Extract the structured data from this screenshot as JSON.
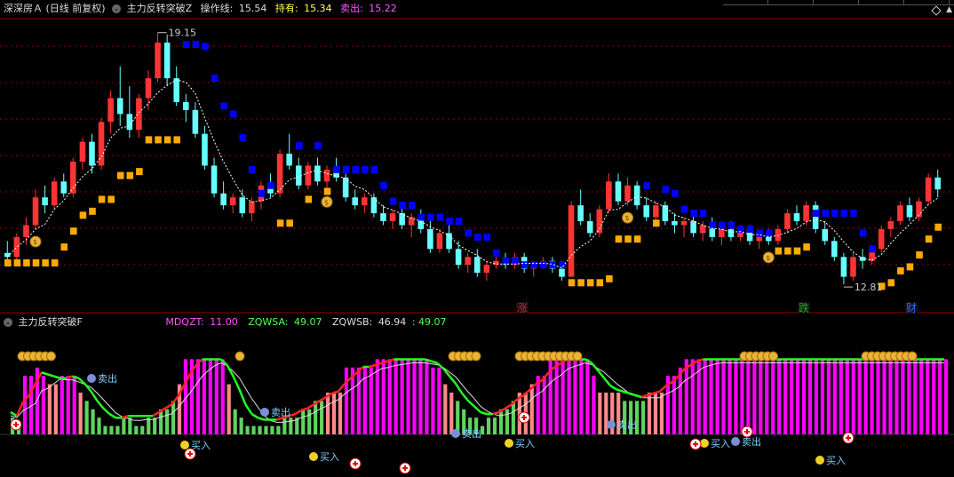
{
  "colors": {
    "up_candle": "#ff3333",
    "down_candle": "#66ffff",
    "support_orange": "#ffaa00",
    "support_blue": "#0000ff",
    "axis_red": "#990000",
    "ind_magenta": "#ff00ff",
    "ind_salmon": "#ff8a8a",
    "ind_green": "#5fd35f",
    "line_green": "#22ff22",
    "line_red": "#ff2222"
  },
  "top_bar": {
    "stock_name": "深深房Ａ",
    "period": "(日线 前复权)",
    "indicator_name": "主力反转突破Z",
    "op_label": "操作线:",
    "op_value": "15.54",
    "hold_label": "持有:",
    "hold_value": "15.34",
    "sell_label": "卖出:",
    "sell_value": "15.22"
  },
  "indicator_bar": {
    "name": "主力反转突破F",
    "mdqzt_label": "MDQZT:",
    "mdqzt_value": "11.00",
    "zqwsa_label": "ZQWSA:",
    "zqwsa_value": "49.07",
    "zqwsb_label": "ZQWSB:",
    "zqwsb_value": "46.94",
    "extra_value": ": 49.07"
  },
  "chart_data": [
    {
      "type": "candlestick",
      "title": "深深房Ａ (日线 前复权)",
      "ohlc_note": "daily candles, approx prices read from chart",
      "high_label": "19.15",
      "low_label": "12.81",
      "news_markers": [
        "涨",
        "跌",
        "财"
      ],
      "candles": [
        [
          13.6,
          13.9,
          13.4,
          13.5
        ],
        [
          13.5,
          14.1,
          13.4,
          14.0
        ],
        [
          14.0,
          14.5,
          13.8,
          14.3
        ],
        [
          14.3,
          15.2,
          14.2,
          15.0
        ],
        [
          15.0,
          15.3,
          14.6,
          14.8
        ],
        [
          14.8,
          15.5,
          14.7,
          15.4
        ],
        [
          15.4,
          15.6,
          15.0,
          15.1
        ],
        [
          15.1,
          16.0,
          15.0,
          15.9
        ],
        [
          15.9,
          16.5,
          15.7,
          16.4
        ],
        [
          16.4,
          16.6,
          15.6,
          15.8
        ],
        [
          15.8,
          17.0,
          15.7,
          16.9
        ],
        [
          16.9,
          17.7,
          16.6,
          17.5
        ],
        [
          17.5,
          18.3,
          16.8,
          17.1
        ],
        [
          17.1,
          17.8,
          16.5,
          16.7
        ],
        [
          16.7,
          17.6,
          16.5,
          17.5
        ],
        [
          17.5,
          18.2,
          17.2,
          18.0
        ],
        [
          18.0,
          19.15,
          17.9,
          18.9
        ],
        [
          18.9,
          19.1,
          17.8,
          18.0
        ],
        [
          18.0,
          18.3,
          17.3,
          17.4
        ],
        [
          17.4,
          17.6,
          16.9,
          17.2
        ],
        [
          17.2,
          17.4,
          16.5,
          16.6
        ],
        [
          16.6,
          16.8,
          15.7,
          15.8
        ],
        [
          15.8,
          16.0,
          15.0,
          15.1
        ],
        [
          15.1,
          15.4,
          14.7,
          14.8
        ],
        [
          14.8,
          15.1,
          14.6,
          15.0
        ],
        [
          15.0,
          15.2,
          14.5,
          14.6
        ],
        [
          14.6,
          15.0,
          14.4,
          14.9
        ],
        [
          14.9,
          15.4,
          14.7,
          15.3
        ],
        [
          15.3,
          15.6,
          15.0,
          15.1
        ],
        [
          15.1,
          16.2,
          15.0,
          16.1
        ],
        [
          16.1,
          16.6,
          15.7,
          15.8
        ],
        [
          15.8,
          16.0,
          15.2,
          15.3
        ],
        [
          15.3,
          15.9,
          15.2,
          15.8
        ],
        [
          15.8,
          16.0,
          15.3,
          15.4
        ],
        [
          15.4,
          15.8,
          15.2,
          15.7
        ],
        [
          15.7,
          16.0,
          15.4,
          15.5
        ],
        [
          15.5,
          15.6,
          14.9,
          15.0
        ],
        [
          15.0,
          15.2,
          14.7,
          14.8
        ],
        [
          14.8,
          15.1,
          14.6,
          15.0
        ],
        [
          15.0,
          15.1,
          14.5,
          14.6
        ],
        [
          14.6,
          14.8,
          14.3,
          14.4
        ],
        [
          14.4,
          14.7,
          14.2,
          14.6
        ],
        [
          14.6,
          14.8,
          14.2,
          14.3
        ],
        [
          14.3,
          14.6,
          14.0,
          14.5
        ],
        [
          14.5,
          14.7,
          14.1,
          14.2
        ],
        [
          14.2,
          14.4,
          13.6,
          13.7
        ],
        [
          13.7,
          14.2,
          13.6,
          14.1
        ],
        [
          14.1,
          14.3,
          13.6,
          13.7
        ],
        [
          13.7,
          13.9,
          13.2,
          13.3
        ],
        [
          13.3,
          13.6,
          13.1,
          13.5
        ],
        [
          13.5,
          13.7,
          13.0,
          13.1
        ],
        [
          13.1,
          13.4,
          12.9,
          13.3
        ],
        [
          13.3,
          13.5,
          13.2,
          13.4
        ],
        [
          13.4,
          13.6,
          13.2,
          13.3
        ],
        [
          13.3,
          13.6,
          13.2,
          13.5
        ],
        [
          13.5,
          13.6,
          13.1,
          13.2
        ],
        [
          13.2,
          13.4,
          13.0,
          13.3
        ],
        [
          13.3,
          13.5,
          13.2,
          13.4
        ],
        [
          13.4,
          13.5,
          13.1,
          13.2
        ],
        [
          13.2,
          13.4,
          12.9,
          13.0
        ],
        [
          13.0,
          14.9,
          13.0,
          14.8
        ],
        [
          14.8,
          15.2,
          14.3,
          14.4
        ],
        [
          14.4,
          14.6,
          14.0,
          14.1
        ],
        [
          14.1,
          14.8,
          14.0,
          14.7
        ],
        [
          14.7,
          15.6,
          14.6,
          15.4
        ],
        [
          15.4,
          15.6,
          14.8,
          14.9
        ],
        [
          14.9,
          15.5,
          14.8,
          15.3
        ],
        [
          15.3,
          15.4,
          14.7,
          14.8
        ],
        [
          14.8,
          15.0,
          14.4,
          14.5
        ],
        [
          14.5,
          14.9,
          14.4,
          14.8
        ],
        [
          14.8,
          14.9,
          14.3,
          14.4
        ],
        [
          14.4,
          14.6,
          14.1,
          14.3
        ],
        [
          14.3,
          14.5,
          14.0,
          14.4
        ],
        [
          14.4,
          14.6,
          14.0,
          14.1
        ],
        [
          14.1,
          14.4,
          13.9,
          14.3
        ],
        [
          14.3,
          14.5,
          13.9,
          14.0
        ],
        [
          14.0,
          14.3,
          13.8,
          14.2
        ],
        [
          14.2,
          14.4,
          13.9,
          14.0
        ],
        [
          14.0,
          14.3,
          13.9,
          14.2
        ],
        [
          14.2,
          14.3,
          13.8,
          13.9
        ],
        [
          13.9,
          14.1,
          13.7,
          14.0
        ],
        [
          14.0,
          14.2,
          13.8,
          13.9
        ],
        [
          13.9,
          14.3,
          13.8,
          14.2
        ],
        [
          14.2,
          14.7,
          14.1,
          14.6
        ],
        [
          14.6,
          14.8,
          14.3,
          14.4
        ],
        [
          14.4,
          14.9,
          14.3,
          14.8
        ],
        [
          14.8,
          14.9,
          14.1,
          14.2
        ],
        [
          14.2,
          14.4,
          13.8,
          13.9
        ],
        [
          13.9,
          14.0,
          13.4,
          13.5
        ],
        [
          13.5,
          13.6,
          12.81,
          13.0
        ],
        [
          13.0,
          13.6,
          12.9,
          13.5
        ],
        [
          13.5,
          13.7,
          13.2,
          13.4
        ],
        [
          13.4,
          13.8,
          13.3,
          13.7
        ],
        [
          13.7,
          14.3,
          13.6,
          14.2
        ],
        [
          14.2,
          14.5,
          14.0,
          14.4
        ],
        [
          14.4,
          14.9,
          14.3,
          14.8
        ],
        [
          14.8,
          15.0,
          14.4,
          14.5
        ],
        [
          14.5,
          15.0,
          14.4,
          14.9
        ],
        [
          14.9,
          15.6,
          14.8,
          15.5
        ],
        [
          15.5,
          15.7,
          15.0,
          15.2
        ]
      ]
    },
    {
      "type": "bar",
      "title": "主力反转突破F",
      "series": [
        {
          "name": "MDQZT",
          "values": [
            2,
            1,
            7,
            7,
            8,
            7,
            6,
            6,
            7,
            7,
            7,
            5,
            4,
            3,
            2,
            1,
            1,
            1,
            2,
            2,
            1,
            1,
            2,
            2,
            3,
            3,
            4,
            6,
            9,
            9,
            9,
            9,
            9,
            9,
            9,
            6,
            3,
            2,
            1,
            1,
            1,
            1,
            1,
            1,
            2,
            2,
            2,
            3,
            3,
            4,
            4,
            5,
            5,
            5,
            8,
            8,
            8,
            8,
            8,
            9,
            9,
            9,
            9,
            9,
            9,
            9,
            9,
            9,
            8,
            8,
            6,
            5,
            4,
            3,
            2,
            2,
            1,
            2,
            2,
            3,
            3,
            4,
            5,
            5,
            6,
            7,
            7,
            9,
            9,
            9,
            9,
            9,
            9,
            9,
            7,
            5,
            5,
            5,
            5,
            4,
            4,
            4,
            4,
            5,
            5,
            5,
            7,
            7,
            8,
            9,
            9,
            9,
            9,
            9,
            9,
            9,
            9,
            9,
            9,
            9,
            9,
            9,
            9,
            9,
            9,
            9,
            9,
            9,
            9,
            9,
            9,
            9,
            9,
            9,
            9,
            9,
            9,
            9,
            9,
            9,
            9,
            9,
            9,
            9,
            9,
            9,
            9,
            9,
            9,
            9,
            9,
            9
          ]
        }
      ],
      "lines": [
        {
          "name": "ZQWSA",
          "last": 49.07
        },
        {
          "name": "ZQWSB",
          "last": 46.94
        }
      ],
      "signals": [
        "卖出",
        "买入",
        "卖出",
        "买入",
        "卖出",
        "买入",
        "卖出",
        "买入",
        "卖出",
        "买入"
      ]
    }
  ]
}
